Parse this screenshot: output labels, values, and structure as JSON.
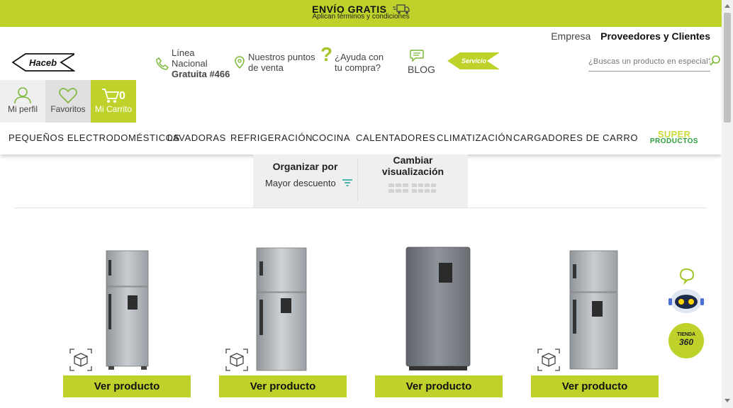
{
  "promo": {
    "title": "ENVÍO GRATIS",
    "subtitle": "Aplican términos y condiciones",
    "truck_icon": "truck-icon"
  },
  "header": {
    "top_links": {
      "empresa": "Empresa",
      "proveedores": "Proveedores y Clientes"
    },
    "logo_text": "Haceb",
    "phone": {
      "line1": "Línea",
      "line2": "Nacional",
      "line3": "Gratuita #466"
    },
    "location": {
      "line1": "Nuestros puntos",
      "line2": "de venta"
    },
    "help": {
      "line1": "¿Ayuda con",
      "line2": "tu compra?"
    },
    "blog": "BLOG",
    "servicio": "Servicio",
    "search_placeholder": "¿Buscas un producto en especial?",
    "user": {
      "perfil": "Mi perfil",
      "favoritos": "Favoritos",
      "carrito": "Mi Carrito",
      "cart_count": "0"
    }
  },
  "nav": {
    "items": [
      "PEQUEÑOS ELECTRODOMÉSTICOS",
      "LAVADORAS",
      "REFRIGERACIÓN",
      "COCINA",
      "CALENTADORES",
      "CLIMATIZACIÓN",
      "CARGADORES DE CARRO"
    ],
    "super_top": "SUPER",
    "super_bottom": "PRODUCTOS"
  },
  "sort": {
    "title": "Organizar por",
    "value": "Mayor descuento",
    "view_title_line1": "Cambiar",
    "view_title_line2": "visualización"
  },
  "products": [
    {
      "button": "Ver producto"
    },
    {
      "button": "Ver producto"
    },
    {
      "button": "Ver producto"
    },
    {
      "button": "Ver producto"
    }
  ],
  "floating": {
    "tienda_top": "TIENDA",
    "tienda_num": "360"
  },
  "colors": {
    "accent": "#bfd22b",
    "green_dark": "#2d9e3e",
    "panel_bg": "#efefef"
  }
}
